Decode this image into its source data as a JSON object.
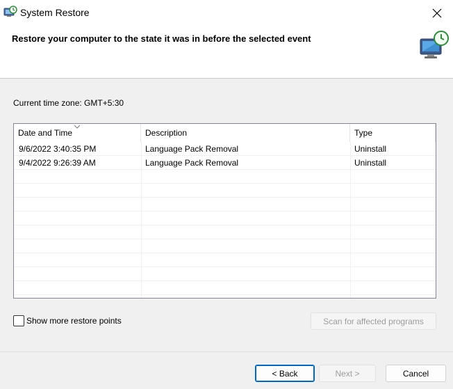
{
  "window": {
    "title": "System Restore"
  },
  "header": {
    "title": "Restore your computer to the state it was in before the selected event"
  },
  "timezone": {
    "label": "Current time zone: GMT+5:30"
  },
  "table": {
    "columns": [
      "Date and Time",
      "Description",
      "Type"
    ],
    "rows": [
      [
        "9/6/2022 3:40:35 PM",
        "Language Pack Removal",
        "Uninstall"
      ],
      [
        "9/4/2022 9:26:39 AM",
        "Language Pack Removal",
        "Uninstall"
      ]
    ]
  },
  "options": {
    "show_more_label": "Show more restore points",
    "show_more_checked": false
  },
  "buttons": {
    "scan": "Scan for affected programs",
    "back": "< Back",
    "next": "Next >",
    "cancel": "Cancel"
  },
  "colors": {
    "accent": "#0067c0",
    "header_bg": "#ffffff",
    "body_bg": "#f0f0f0"
  },
  "icons": {
    "app": "system-restore-icon",
    "header": "system-restore-monitor-icon",
    "close": "close-icon"
  }
}
